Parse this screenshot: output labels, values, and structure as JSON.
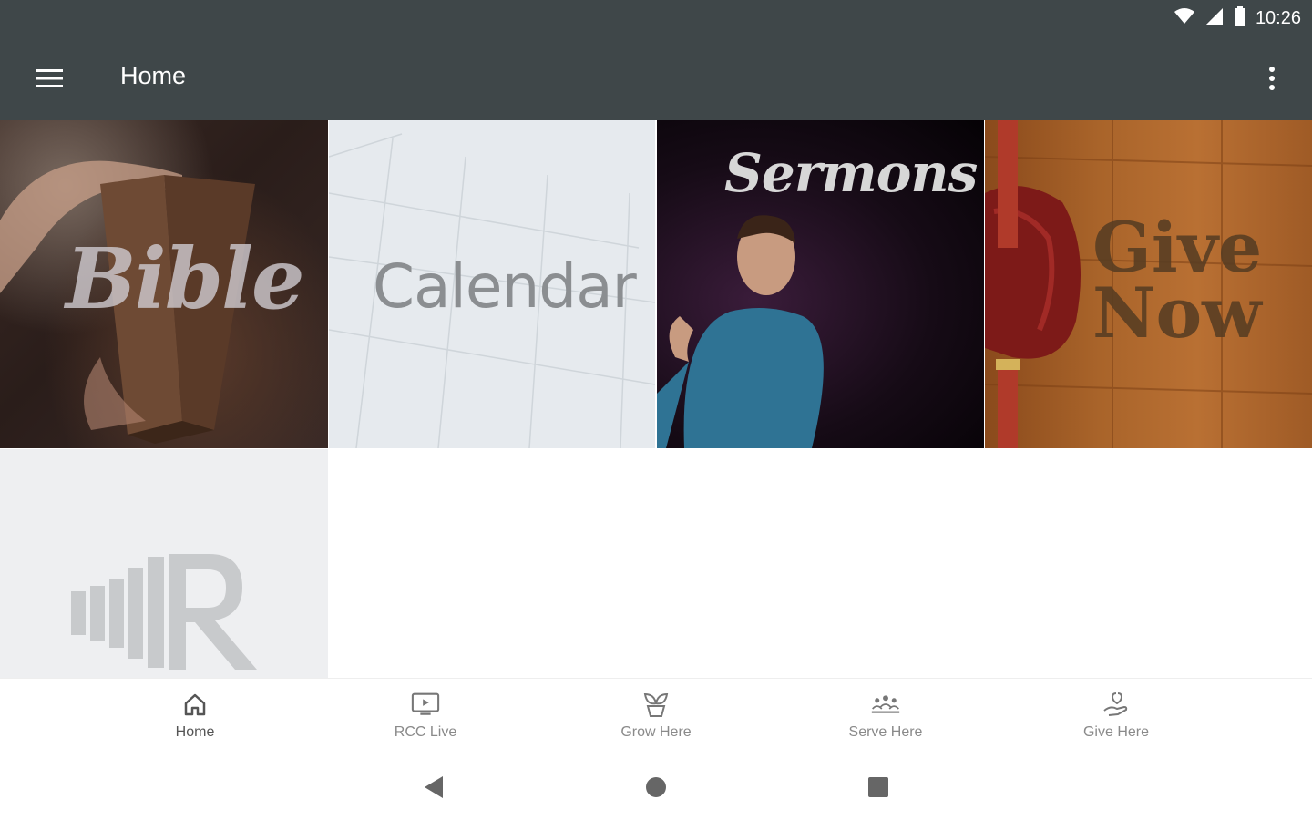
{
  "status_bar": {
    "time": "10:26",
    "icons": [
      "wifi-icon",
      "cell-signal-icon",
      "battery-icon"
    ]
  },
  "app_bar": {
    "title": "Home",
    "menu_icon": "hamburger-menu-icon",
    "overflow_icon": "more-vert-icon",
    "background": "#3f4749"
  },
  "tiles": [
    {
      "label": "Bible"
    },
    {
      "label": "Calendar"
    },
    {
      "label": "Sermons"
    },
    {
      "label": "Give Now"
    },
    {
      "label": ""
    }
  ],
  "bottom_nav": {
    "items": [
      {
        "label": "Home",
        "icon": "home-icon"
      },
      {
        "label": "RCC Live",
        "icon": "tv-icon"
      },
      {
        "label": "Grow Here",
        "icon": "plant-icon"
      },
      {
        "label": "Serve Here",
        "icon": "group-icon"
      },
      {
        "label": "Give Here",
        "icon": "giving-hand-icon"
      }
    ]
  },
  "system_nav": {
    "icons": [
      "back-icon",
      "home-circle-icon",
      "recents-icon"
    ]
  }
}
